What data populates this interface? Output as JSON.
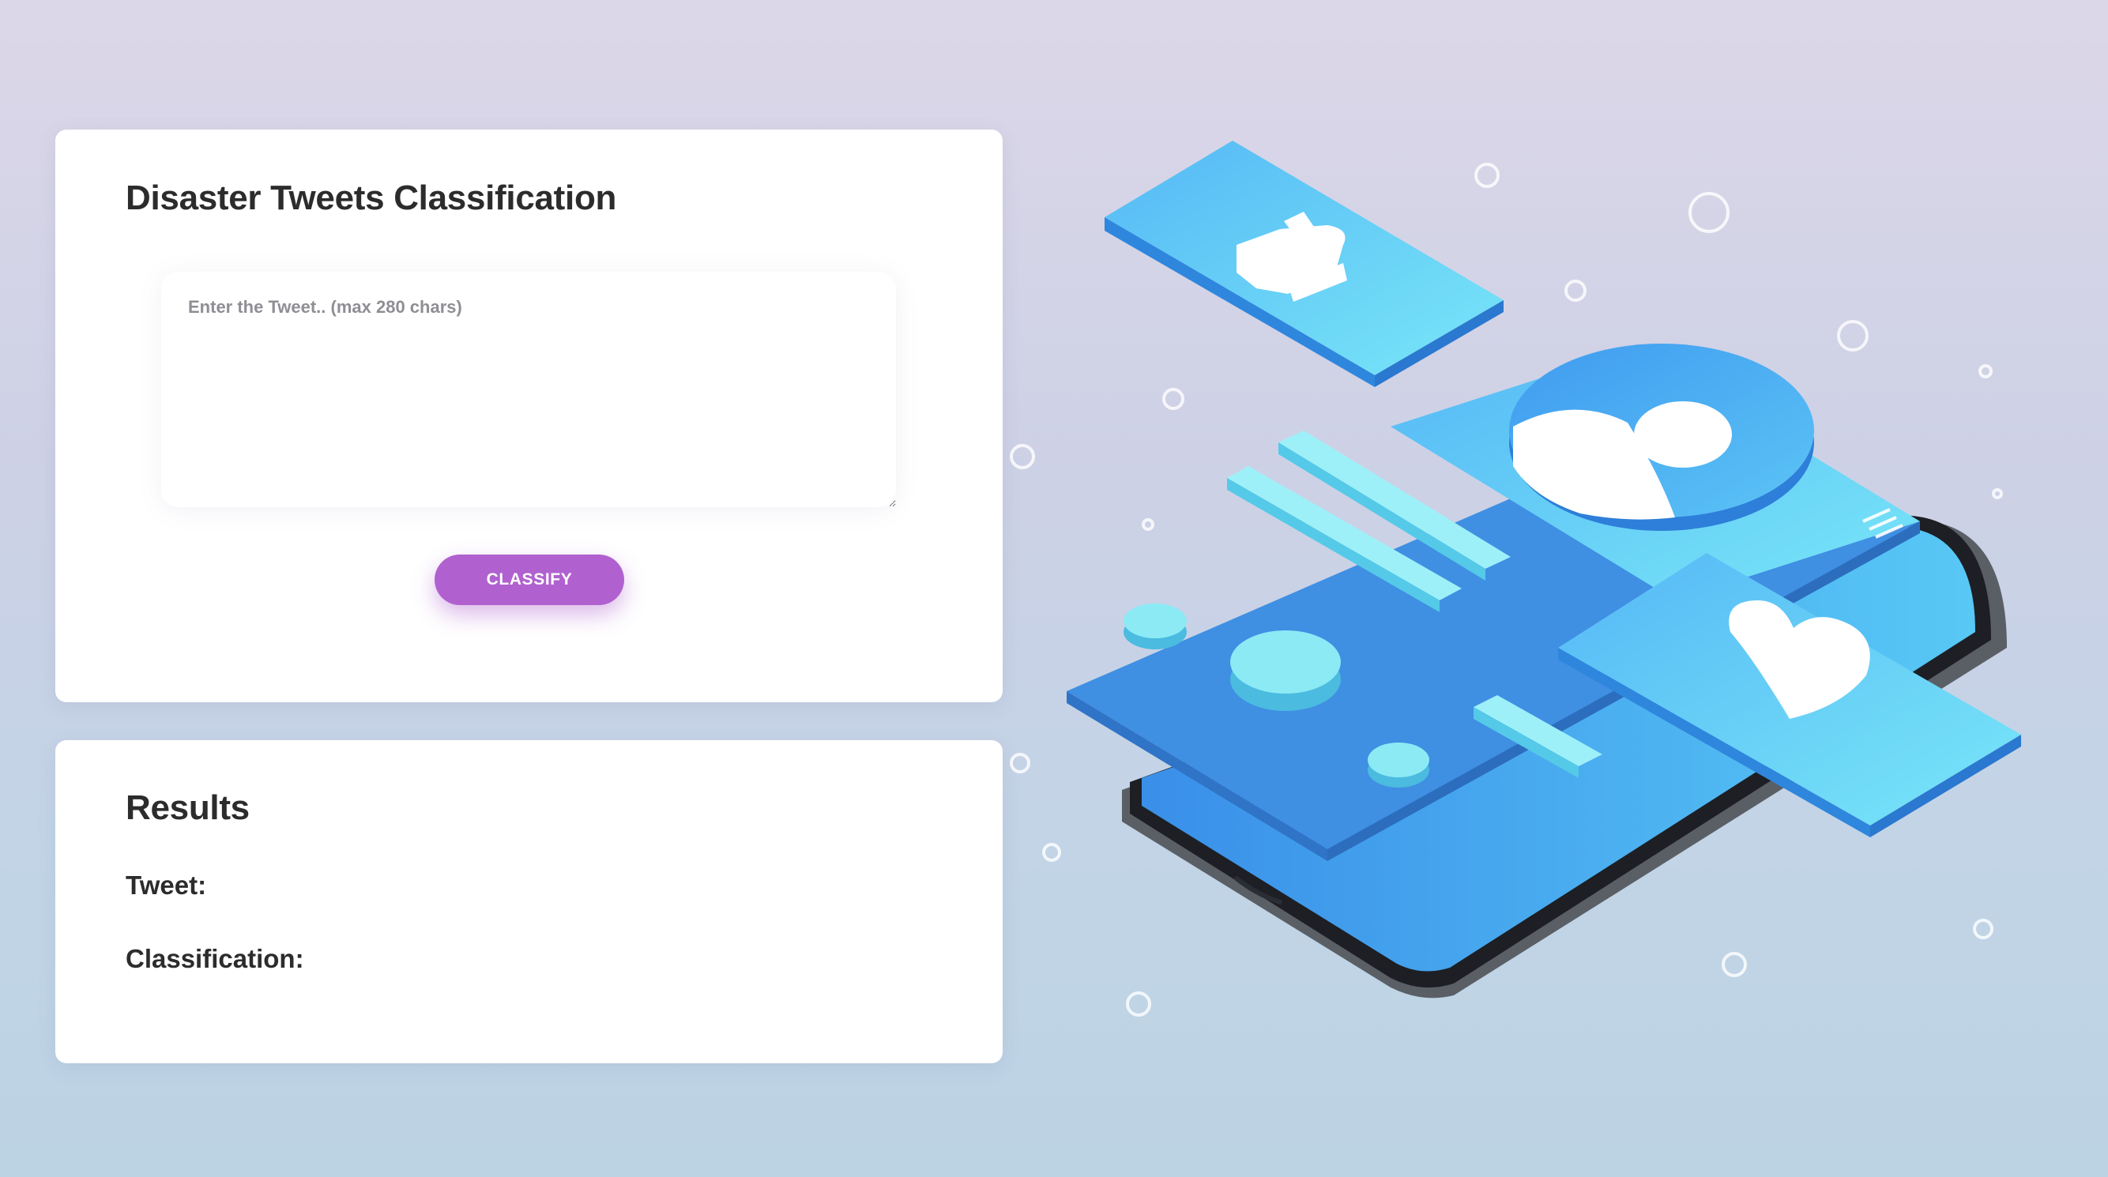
{
  "form": {
    "title": "Disaster Tweets Classification",
    "tweet_placeholder": "Enter the Tweet.. (max 280 chars)",
    "tweet_value": "",
    "classify_label": "CLASSIFY"
  },
  "results": {
    "title": "Results",
    "tweet_label": "Tweet:",
    "tweet_value": "",
    "classification_label": "Classification:",
    "classification_value": ""
  },
  "colors": {
    "accent": "#b061cf",
    "illustration_blue": "#4aa3f0",
    "illustration_cyan": "#6fe3f5"
  },
  "illustration": {
    "icons": [
      "thumbs-up-icon",
      "user-icon",
      "heart-icon",
      "menu-icon"
    ]
  }
}
